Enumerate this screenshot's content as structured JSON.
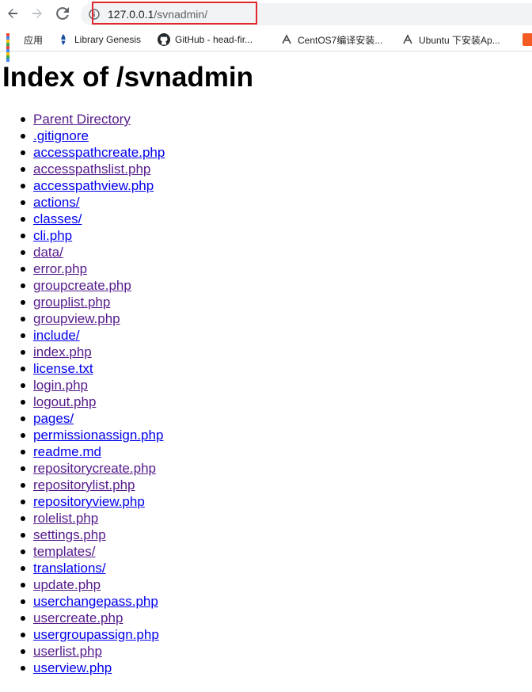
{
  "browser": {
    "url_host": "127.0.0.1",
    "url_path": "/svnadmin/",
    "bookmarks": [
      {
        "label": "应用",
        "icon": "apps-grid-icon"
      },
      {
        "label": "Library Genesis",
        "icon": "library-genesis-icon"
      },
      {
        "label": "GitHub - head-fir...",
        "icon": "github-icon"
      },
      {
        "label": "CentOS7编译安装...",
        "icon": "bookmark-favicon-icon"
      },
      {
        "label": "Ubuntu 下安装Ap...",
        "icon": "bookmark-favicon-icon"
      }
    ],
    "highlight_color": "#e0272d"
  },
  "page": {
    "title": "Index of /svnadmin",
    "entries": [
      {
        "label": "Parent Directory",
        "visited": true
      },
      {
        "label": ".gitignore",
        "visited": false
      },
      {
        "label": "accesspathcreate.php",
        "visited": false
      },
      {
        "label": "accesspathslist.php",
        "visited": true
      },
      {
        "label": "accesspathview.php",
        "visited": false
      },
      {
        "label": "actions/",
        "visited": false
      },
      {
        "label": "classes/",
        "visited": false
      },
      {
        "label": "cli.php",
        "visited": false
      },
      {
        "label": "data/",
        "visited": true
      },
      {
        "label": "error.php",
        "visited": true
      },
      {
        "label": "groupcreate.php",
        "visited": true
      },
      {
        "label": "grouplist.php",
        "visited": true
      },
      {
        "label": "groupview.php",
        "visited": true
      },
      {
        "label": "include/",
        "visited": false
      },
      {
        "label": "index.php",
        "visited": true
      },
      {
        "label": "license.txt",
        "visited": false
      },
      {
        "label": "login.php",
        "visited": true
      },
      {
        "label": "logout.php",
        "visited": true
      },
      {
        "label": "pages/",
        "visited": false
      },
      {
        "label": "permissionassign.php",
        "visited": false
      },
      {
        "label": "readme.md",
        "visited": false
      },
      {
        "label": "repositorycreate.php",
        "visited": true
      },
      {
        "label": "repositorylist.php",
        "visited": true
      },
      {
        "label": "repositoryview.php",
        "visited": false
      },
      {
        "label": "rolelist.php",
        "visited": true
      },
      {
        "label": "settings.php",
        "visited": true
      },
      {
        "label": "templates/",
        "visited": true
      },
      {
        "label": "translations/",
        "visited": false
      },
      {
        "label": "update.php",
        "visited": true
      },
      {
        "label": "userchangepass.php",
        "visited": false
      },
      {
        "label": "usercreate.php",
        "visited": true
      },
      {
        "label": "usergroupassign.php",
        "visited": false
      },
      {
        "label": "userlist.php",
        "visited": true
      },
      {
        "label": "userview.php",
        "visited": false
      }
    ],
    "link_color_unvisited": "#0000ee",
    "link_color_visited": "#551a8b"
  }
}
